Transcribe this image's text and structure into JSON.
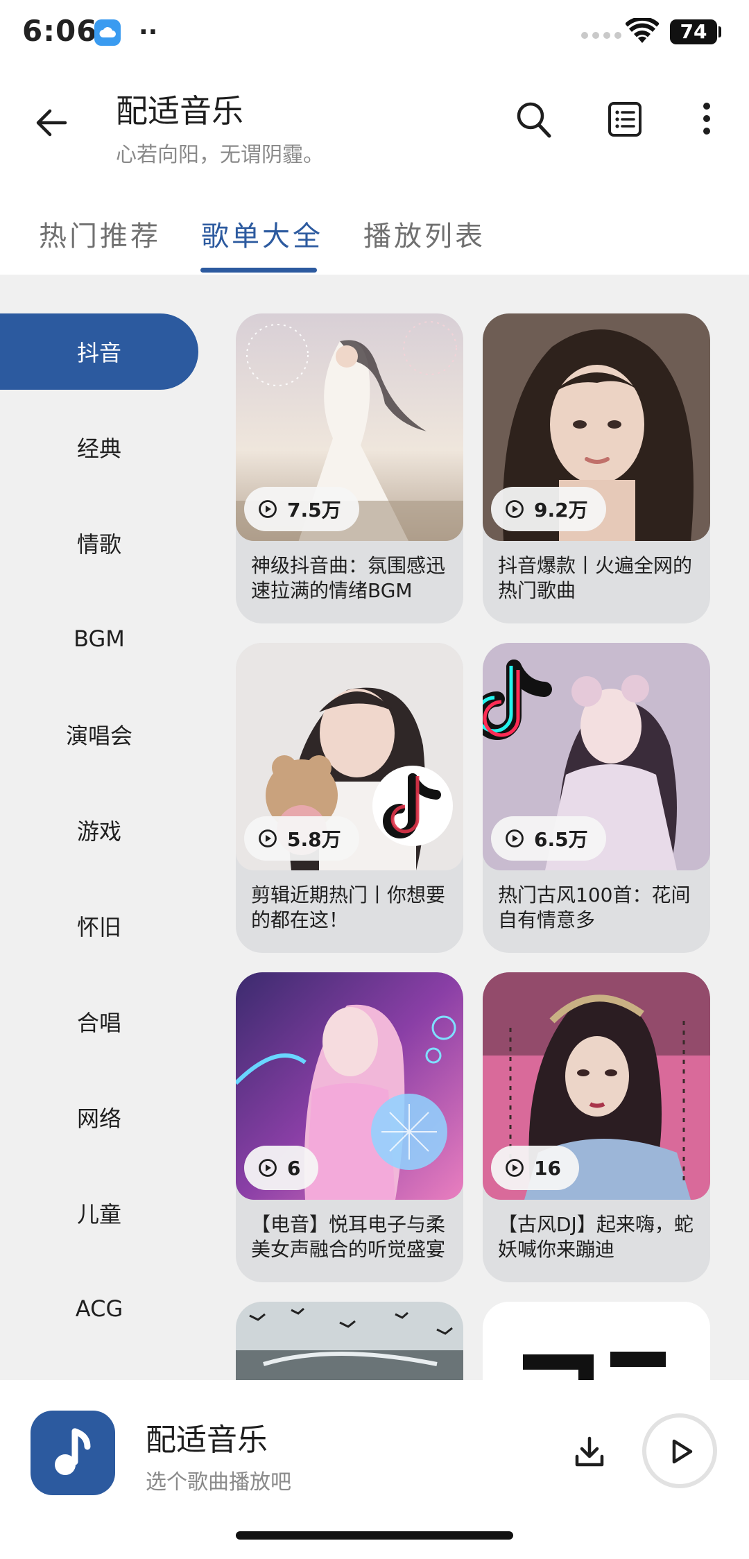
{
  "status_bar": {
    "time": "6:06",
    "extra": "··",
    "battery": "74"
  },
  "header": {
    "title": "配适音乐",
    "subtitle": "心若向阳，无谓阴霾。",
    "icons": [
      "back-arrow-icon",
      "search-icon",
      "list-icon",
      "more-vert-icon"
    ]
  },
  "tabs": [
    {
      "label": "热门推荐",
      "active": false
    },
    {
      "label": "歌单大全",
      "active": true
    },
    {
      "label": "播放列表",
      "active": false
    }
  ],
  "sidebar": {
    "items": [
      {
        "label": "抖音",
        "active": true
      },
      {
        "label": "经典"
      },
      {
        "label": "情歌"
      },
      {
        "label": "BGM"
      },
      {
        "label": "演唱会"
      },
      {
        "label": "游戏"
      },
      {
        "label": "怀旧"
      },
      {
        "label": "合唱"
      },
      {
        "label": "网络"
      },
      {
        "label": "儿童"
      },
      {
        "label": "ACG"
      }
    ]
  },
  "playlists": [
    {
      "count": "7.5万",
      "title": "神级抖音曲：氛围感迅速拉满的情绪BGM"
    },
    {
      "count": "9.2万",
      "title": "抖音爆款丨火遍全网的热门歌曲"
    },
    {
      "count": "5.8万",
      "title": "剪辑近期热门丨你想要的都在这！"
    },
    {
      "count": "6.5万",
      "title": "热门古风100首：花间自有情意多"
    },
    {
      "count": "6",
      "title": "【电音】悦耳电子与柔美女声融合的听觉盛宴"
    },
    {
      "count": "16",
      "title": "【古风DJ】起来嗨，蛇妖喊你来蹦迪"
    }
  ],
  "player": {
    "title": "配适音乐",
    "subtitle": "选个歌曲播放吧",
    "icons": [
      "music-note-icon",
      "download-icon",
      "play-icon"
    ]
  },
  "colors": {
    "accent": "#2c5a9f",
    "background": "#f0f0f0",
    "card": "#dedfe1"
  }
}
